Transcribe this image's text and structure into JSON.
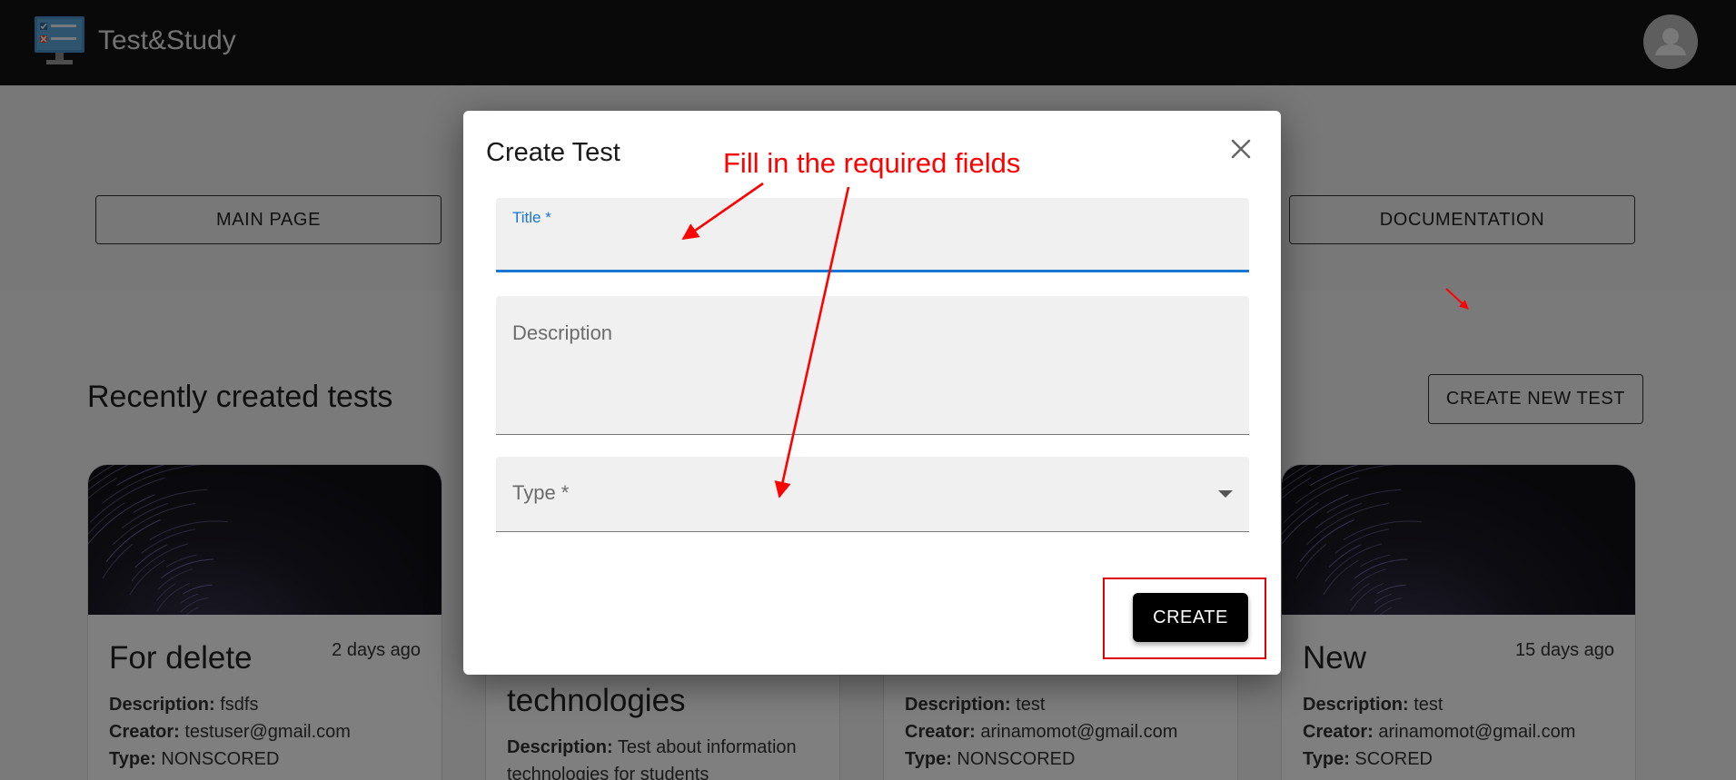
{
  "app": {
    "title": "Test&Study",
    "logo_icon": "computer-test-logo-icon",
    "avatar_icon": "person-icon"
  },
  "nav": {
    "main_page": "MAIN PAGE",
    "documentation": "DOCUMENTATION"
  },
  "section": {
    "title": "Recently created tests",
    "create_button": "CREATE NEW TEST"
  },
  "cards": [
    {
      "title": "For delete",
      "time": "2 days ago",
      "description_label": "Description:",
      "description": "fsdfs",
      "creator_label": "Creator:",
      "creator": "testuser@gmail.com",
      "type_label": "Type:",
      "type": "NONSCORED"
    },
    {
      "title": "technologies",
      "description_label": "Description:",
      "description": "Test about information",
      "description_cont": "technologies for students"
    },
    {
      "description_label": "Description:",
      "description": "test",
      "creator_label": "Creator:",
      "creator": "arinamomot@gmail.com",
      "type_label": "Type:",
      "type": "NONSCORED"
    },
    {
      "title": "New",
      "time": "15 days ago",
      "description_label": "Description:",
      "description": "test",
      "creator_label": "Creator:",
      "creator": "arinamomot@gmail.com",
      "type_label": "Type:",
      "type": "SCORED"
    }
  ],
  "dialog": {
    "title": "Create Test",
    "title_field": {
      "label": "Title *",
      "value": ""
    },
    "description_field": {
      "placeholder": "Description",
      "value": ""
    },
    "type_field": {
      "label": "Type *",
      "value": ""
    },
    "create_button": "CREATE",
    "close_icon": "close-icon"
  },
  "annotation": {
    "text": "Fill in the required fields",
    "color": "#ff0000"
  },
  "colors": {
    "appbar": "#121212",
    "focus": "#1976d2",
    "button": "#000000",
    "annotation": "#ff0000"
  }
}
